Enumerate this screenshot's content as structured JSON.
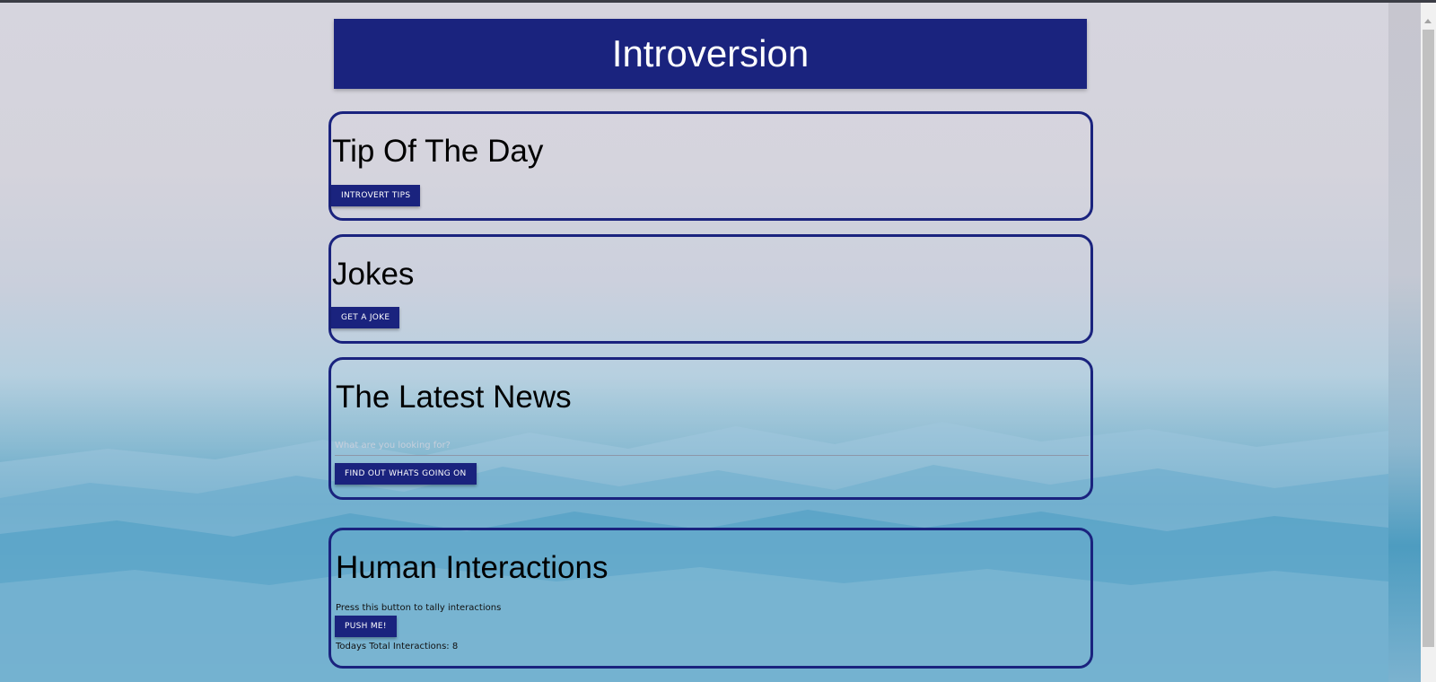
{
  "header": {
    "title": "Introversion"
  },
  "tip_card": {
    "title": "Tip Of The Day",
    "button_label": "INTROVERT TIPS"
  },
  "jokes_card": {
    "title": "Jokes",
    "button_label": "GET A JOKE"
  },
  "news_card": {
    "title": "The Latest News",
    "search_placeholder": "What are you looking for?",
    "search_value": "",
    "button_label": "FIND OUT WHATS GOING ON"
  },
  "interactions_card": {
    "title": "Human Interactions",
    "instruction": "Press this button to tally interactions",
    "button_label": "PUSH ME!",
    "total_label": "Todays Total Interactions: 8"
  },
  "colors": {
    "primary": "#1a237e",
    "button_text": "#ffffff"
  }
}
